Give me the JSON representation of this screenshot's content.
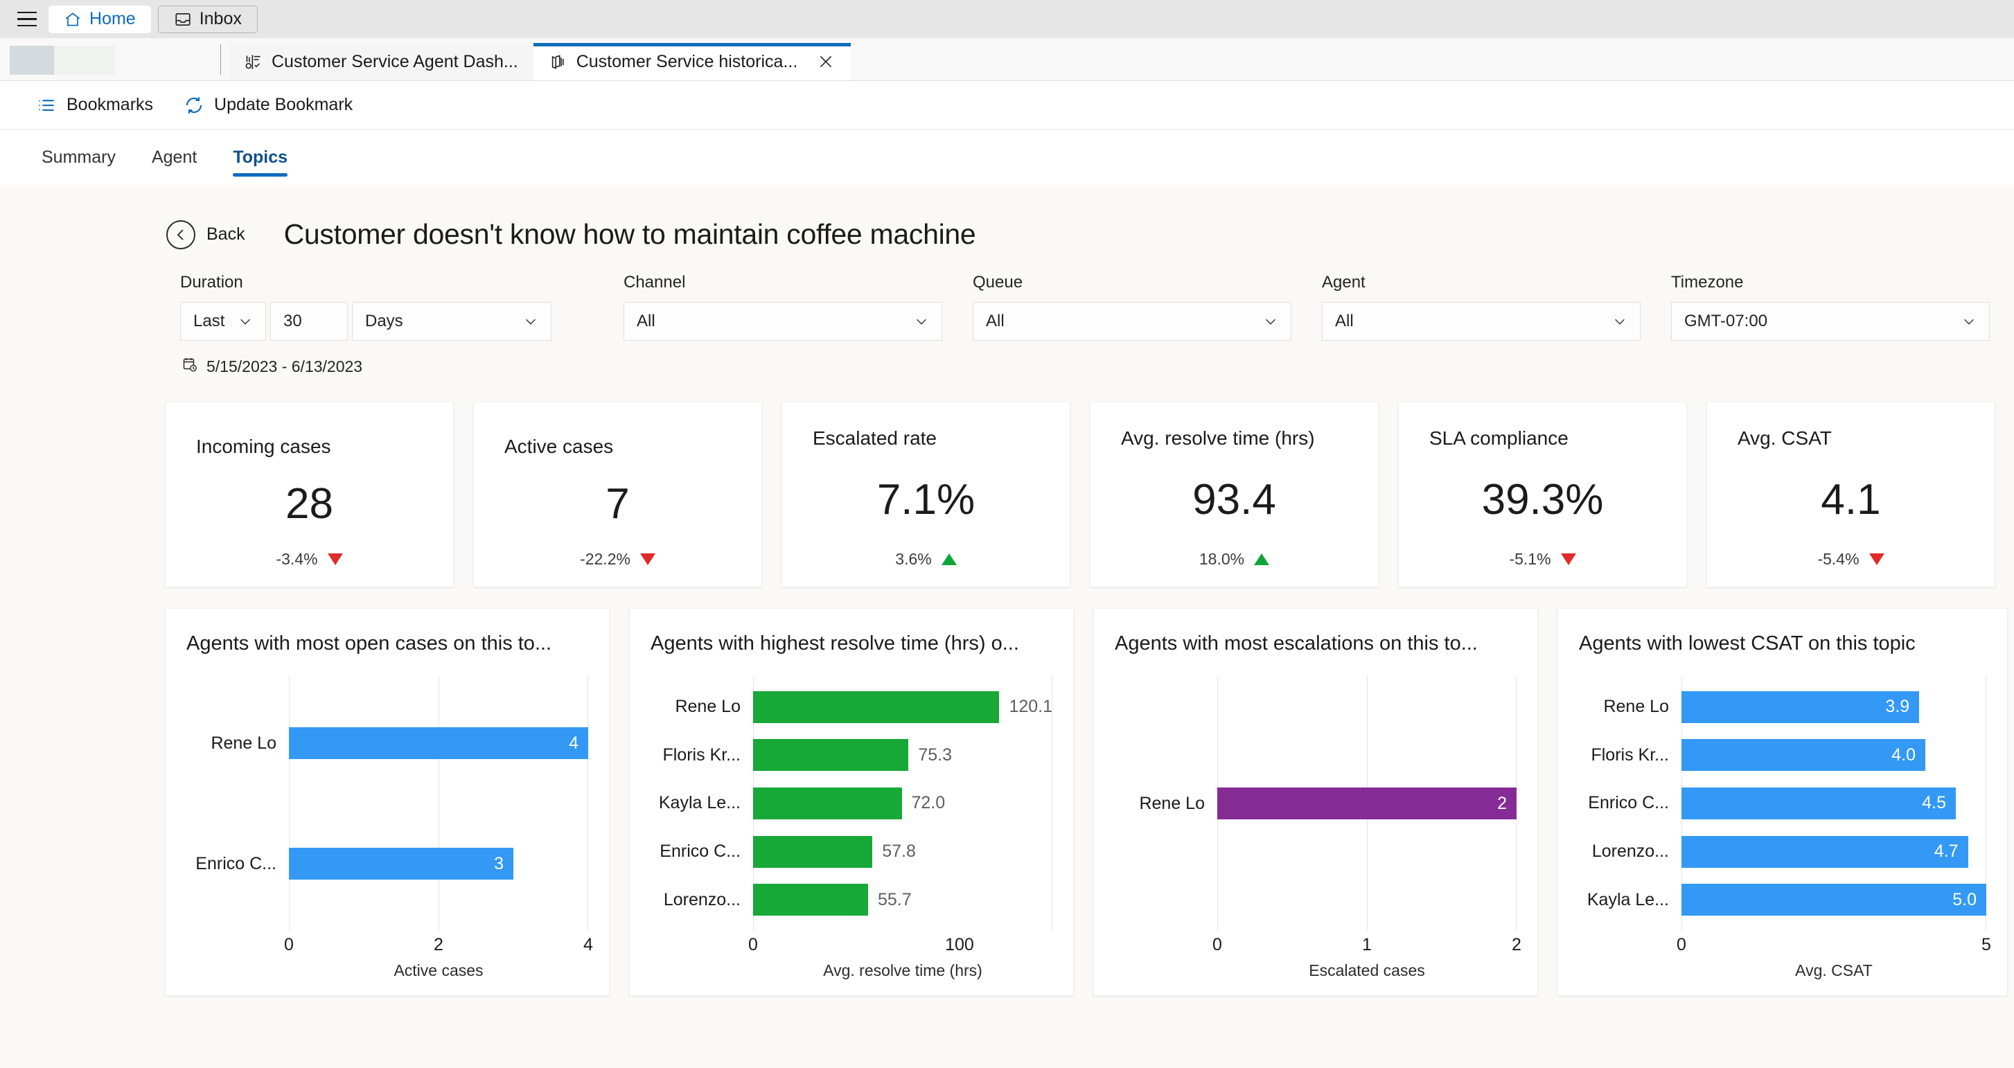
{
  "appbar": {
    "menu_icon": "hamburger-icon",
    "nav": [
      {
        "label": "Home",
        "icon": "home-icon",
        "active": true
      },
      {
        "label": "Inbox",
        "icon": "inbox-icon",
        "active": false
      }
    ]
  },
  "tabstrip": {
    "tabs": [
      {
        "label": "Customer Service Agent Dash...",
        "icon": "dashboard-icon",
        "active": false
      },
      {
        "label": "Customer Service historica...",
        "icon": "report-icon",
        "active": true
      }
    ],
    "close_icon": "close-icon",
    "accent": "#0f6cbd"
  },
  "commandbar": {
    "items": [
      {
        "label": "Bookmarks",
        "icon": "bookmarks-icon"
      },
      {
        "label": "Update Bookmark",
        "icon": "refresh-icon"
      }
    ]
  },
  "pagetabs": [
    {
      "label": "Summary",
      "active": false
    },
    {
      "label": "Agent",
      "active": false
    },
    {
      "label": "Topics",
      "active": true
    }
  ],
  "header": {
    "back_label": "Back",
    "back_icon": "arrow-left-circle-icon",
    "title": "Customer doesn't know how to maintain coffee machine"
  },
  "filters": {
    "duration": {
      "label": "Duration",
      "relative": "Last",
      "amount": "30",
      "unit": "Days"
    },
    "channel": {
      "label": "Channel",
      "value": "All"
    },
    "queue": {
      "label": "Queue",
      "value": "All"
    },
    "agent": {
      "label": "Agent",
      "value": "All"
    },
    "timezone": {
      "label": "Timezone",
      "value": "GMT-07:00"
    },
    "date_range": "5/15/2023 - 6/13/2023",
    "calendar_icon": "calendar-clock-icon"
  },
  "kpis": [
    {
      "title": "Incoming cases",
      "value": "28",
      "delta": "-3.4%",
      "direction": "down"
    },
    {
      "title": "Active cases",
      "value": "7",
      "delta": "-22.2%",
      "direction": "down"
    },
    {
      "title": "Escalated rate",
      "value": "7.1%",
      "delta": "3.6%",
      "direction": "up"
    },
    {
      "title": "Avg. resolve time (hrs)",
      "value": "93.4",
      "delta": "18.0%",
      "direction": "up"
    },
    {
      "title": "SLA compliance",
      "value": "39.3%",
      "delta": "-5.1%",
      "direction": "down"
    },
    {
      "title": "Avg. CSAT",
      "value": "4.1",
      "delta": "-5.4%",
      "direction": "down"
    }
  ],
  "colors": {
    "bar_blue": "#3399f4",
    "bar_green": "#17a837",
    "bar_purple": "#852b96",
    "up_green": "#10a53a",
    "down_red": "#e02b2b"
  },
  "chart_data": [
    {
      "type": "bar",
      "orientation": "horizontal",
      "title": "Agents with most open cases on this to...",
      "categories": [
        "Rene Lo",
        "Enrico C..."
      ],
      "values": [
        4,
        3
      ],
      "value_labels": [
        "4",
        "3"
      ],
      "labels_inside": true,
      "color": "#3399f4",
      "xlabel": "Active cases",
      "ylabel": "",
      "xlim": [
        0,
        4
      ],
      "xticks": [
        0,
        2,
        4
      ],
      "xticklabels": [
        "0",
        "2",
        "4"
      ],
      "grid": true
    },
    {
      "type": "bar",
      "orientation": "horizontal",
      "title": "Agents with highest resolve time (hrs) o...",
      "categories": [
        "Rene Lo",
        "Floris Kr...",
        "Kayla Le...",
        "Enrico C...",
        "Lorenzo..."
      ],
      "values": [
        120.1,
        75.3,
        72.0,
        57.8,
        55.7
      ],
      "value_labels": [
        "120.1",
        "75.3",
        "72.0",
        "57.8",
        "55.7"
      ],
      "labels_inside": false,
      "color": "#17a837",
      "xlabel": "Avg. resolve time (hrs)",
      "ylabel": "",
      "xlim": [
        0,
        145
      ],
      "xticks": [
        0,
        100
      ],
      "xticklabels": [
        "0",
        "100"
      ],
      "grid": true
    },
    {
      "type": "bar",
      "orientation": "horizontal",
      "title": "Agents with most escalations on this to...",
      "categories": [
        "Rene Lo"
      ],
      "values": [
        2
      ],
      "value_labels": [
        "2"
      ],
      "labels_inside": true,
      "color": "#852b96",
      "xlabel": "Escalated cases",
      "ylabel": "",
      "xlim": [
        0,
        2
      ],
      "xticks": [
        0,
        1,
        2
      ],
      "xticklabels": [
        "0",
        "1",
        "2"
      ],
      "grid": true
    },
    {
      "type": "bar",
      "orientation": "horizontal",
      "title": "Agents with lowest CSAT on this topic",
      "categories": [
        "Rene Lo",
        "Floris Kr...",
        "Enrico C...",
        "Lorenzo...",
        "Kayla Le..."
      ],
      "values": [
        3.9,
        4.0,
        4.5,
        4.7,
        5.0
      ],
      "value_labels": [
        "3.9",
        "4.0",
        "4.5",
        "4.7",
        "5.0"
      ],
      "labels_inside": true,
      "color": "#3399f4",
      "xlabel": "Avg. CSAT",
      "ylabel": "",
      "xlim": [
        0,
        5
      ],
      "xticks": [
        0,
        5
      ],
      "xticklabels": [
        "0",
        "5"
      ],
      "grid": true
    }
  ]
}
